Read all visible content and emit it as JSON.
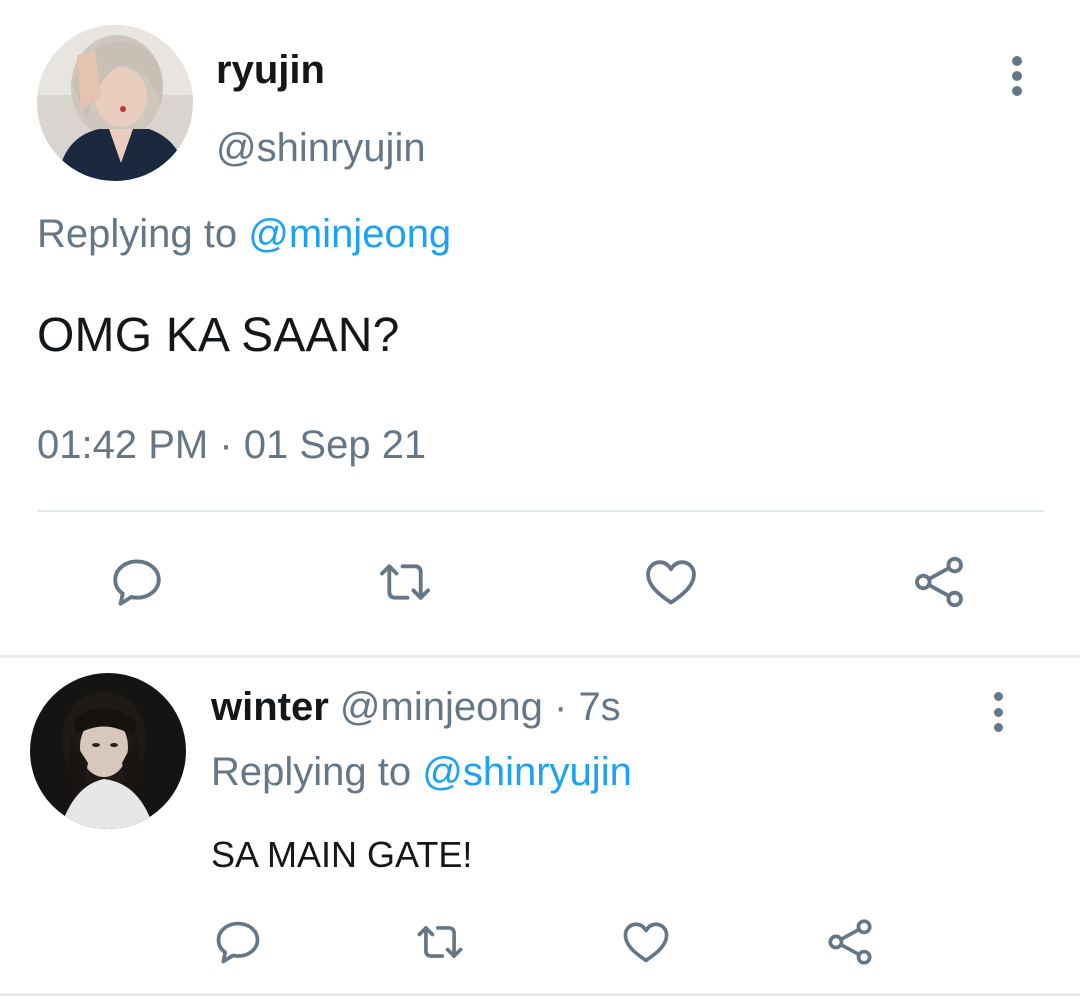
{
  "main_tweet": {
    "display_name": "ryujin",
    "handle": "@shinryujin",
    "replying_prefix": "Replying to",
    "replying_to": "@minjeong",
    "text": "OMG KA SAAN?",
    "time": "01:42 PM",
    "separator": "·",
    "date": "01 Sep 21",
    "actions": [
      "reply-icon",
      "retweet-icon",
      "like-icon",
      "share-icon"
    ]
  },
  "reply_tweet": {
    "display_name": "winter",
    "handle": "@minjeong",
    "separator": "·",
    "age": "7s",
    "replying_prefix": "Replying to",
    "replying_to": "@shinryujin",
    "text": "SA MAIN GATE!",
    "actions": [
      "reply-icon",
      "retweet-icon",
      "like-icon",
      "share-icon"
    ]
  },
  "colors": {
    "text_primary": "#14171a",
    "text_secondary": "#657786",
    "accent": "#1da1f2",
    "divider": "#e1e8ed"
  }
}
